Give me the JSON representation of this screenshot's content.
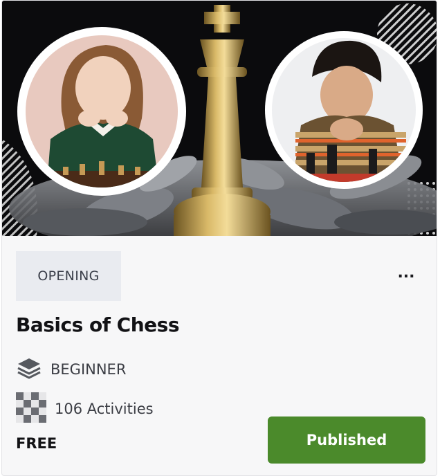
{
  "course": {
    "category_tag": "OPENING",
    "more_label": "...",
    "title": "Basics of Chess",
    "level": "BEGINNER",
    "activities": "106 Activities",
    "price": "FREE",
    "status_button": "Published"
  },
  "colors": {
    "status_green": "#4b8a2b",
    "tag_background": "#e9ebf0",
    "card_background": "#f7f7f8"
  },
  "icons": {
    "more": "more-horizontal-icon",
    "level": "layers-icon",
    "activities": "chessboard-icon"
  }
}
